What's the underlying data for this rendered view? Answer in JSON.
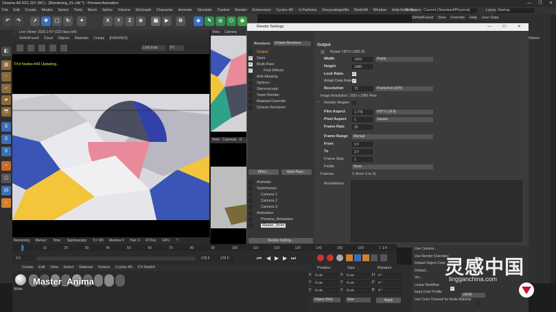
{
  "app": {
    "title": "Cinema 4D R21.207 (RC) - [Rendering_01.c4d *] - Preview Animation",
    "window_controls": [
      "—",
      "❐",
      "✕"
    ]
  },
  "menubar": {
    "items": [
      "File",
      "Edit",
      "Create",
      "Modes",
      "Select",
      "Tools",
      "Mesh",
      "Spline",
      "Volume",
      "MoGraph",
      "Character",
      "Animate",
      "Simulate",
      "Tracker",
      "Render",
      "Extensions",
      "Cycles 4D",
      "X-Particles",
      "Greyscalegorilla",
      "Redshift",
      "Window",
      "Help",
      "Octane"
    ],
    "node_space_label": "Node Space:",
    "node_space_value": "Current (Standard/Physical)",
    "layout_label": "Layout:",
    "layout_value": "Startup"
  },
  "right_header": {
    "items": [
      "StrNotFound",
      "View",
      "Override",
      "Help",
      "User Data"
    ],
    "owner": "Owner"
  },
  "live_viewer": {
    "title": "Live Viewer 2020.1-R7 (322 days left)",
    "menu": [
      "StrNotFound",
      "Cloud",
      "Objects",
      "Materials",
      "Comps",
      "[FINISHED]"
    ],
    "ldr": "LDR 8-bit",
    "pt": "PT",
    "status_overlay": "Tri'd Nodes:443  Updating..",
    "status_bar": [
      "Rendering",
      "Ms/sec:",
      "Time:",
      "Spp/maxspp:",
      "Tri: 0/0",
      "Meshes 0",
      "Hair: 0",
      "RTXon",
      "GPU:",
      "?"
    ]
  },
  "viewport2": {
    "tabs": [
      "View",
      "Camera"
    ],
    "tabs2": [
      "View",
      "Cameras",
      "D"
    ]
  },
  "render_settings": {
    "title": "Render Settings",
    "renderer_label": "Renderer",
    "renderer_value": "Octane Renderer",
    "tree": [
      {
        "label": "Output",
        "checked": false,
        "selected": true
      },
      {
        "label": "Save",
        "checked": true,
        "selected": false
      },
      {
        "label": "Multi-Pass",
        "checked": true,
        "selected": false
      },
      {
        "label": "Post Effects",
        "checked": true,
        "selected": false
      },
      {
        "label": "Anti-Aliasing",
        "checked": false,
        "selected": false
      },
      {
        "label": "Options",
        "checked": false,
        "selected": false
      },
      {
        "label": "Stereoscopic",
        "checked": false,
        "selected": false
      },
      {
        "label": "Team Render",
        "checked": false,
        "selected": false
      },
      {
        "label": "Material Override",
        "checked": false,
        "selected": false
      },
      {
        "label": "Octane Renderer",
        "checked": false,
        "selected": false
      }
    ],
    "effect_button": "Effect...",
    "multipass_button": "Multi-Pass...",
    "takes": [
      "Animatic",
      "Styleframes",
      "Camera 1",
      "Camera 2",
      "Camera 3",
      "Animation",
      "Preview_Animation",
      "Master_Anim"
    ],
    "render_setting_button": "Render Setting...",
    "output": {
      "section": "Output",
      "preset": "Preset: HDTV 1080 25",
      "width_label": "Width",
      "width_value": "1920",
      "width_unit": "Pixels",
      "height_label": "Height",
      "height_value": "1080",
      "lock_ratio": "Lock Ratio",
      "adapt_data_rate": "Adapt Data Rate",
      "resolution_label": "Resolution",
      "resolution_value": "72",
      "resolution_unit": "Pixels/Inch (DPI)",
      "image_resolution": "Image Resolution: 1920 x 1080 Pixel",
      "render_region": "Render Region",
      "film_aspect_label": "Film Aspect",
      "film_aspect_value": "1.778",
      "film_aspect_preset": "HDTV (16:9)",
      "pixel_aspect_label": "Pixel Aspect",
      "pixel_aspect_value": "1",
      "pixel_aspect_preset": "Square",
      "frame_rate_label": "Frame Rate",
      "frame_rate_value": "25",
      "frame_range_label": "Frame Range",
      "frame_range_value": "Manual",
      "from_label": "From",
      "from_value": "3 F",
      "to_label": "To",
      "to_value": "3 F",
      "frame_step_label": "Frame Step",
      "frame_step_value": "1",
      "fields_label": "Fields",
      "fields_value": "None",
      "frames_label": "Frames:",
      "frames_value": "1 (from 3 to 3)",
      "annotations": "Annotations"
    }
  },
  "timeline": {
    "ticks": [
      "0",
      "10",
      "20",
      "30",
      "40",
      "50",
      "60",
      "70",
      "80",
      "90",
      "100",
      "110",
      "120",
      "130",
      "140",
      "150",
      "160",
      "170"
    ],
    "start": "0 F",
    "current": "175 F",
    "end": "175 F",
    "frame_field": "1 F"
  },
  "material_manager": {
    "menu": [
      "Create",
      "Edit",
      "View",
      "Select",
      "Material",
      "Texture",
      "Cycles 4D",
      "CV-Switch"
    ],
    "material_name": "Master_Anima",
    "material_label": "White"
  },
  "coordinates": {
    "headers": [
      "Position",
      "Size",
      "Rotation"
    ],
    "rows": [
      {
        "axis": "X",
        "pos": "0 cm",
        "sizeaxis": "X",
        "size": "0 cm",
        "rotaxis": "H",
        "rot": "0 °"
      },
      {
        "axis": "Y",
        "pos": "0 cm",
        "sizeaxis": "Y",
        "size": "0 cm",
        "rotaxis": "P",
        "rot": "0 °"
      },
      {
        "axis": "Z",
        "pos": "0 cm",
        "sizeaxis": "Z",
        "size": "0 cm",
        "rotaxis": "B",
        "rot": "0 °"
      }
    ],
    "mode": "Object (Rel)",
    "size_mode": "Size",
    "apply": "Apply"
  },
  "attributes": {
    "items": [
      "Use Camera...",
      "Use Render Overrides",
      "Default Object Color",
      "Default...",
      "Vie...",
      "Linear Workflow",
      "Input Color Profile",
      "Use Color Channel for Node Material"
    ],
    "input_color_profile_value": "sRGB"
  },
  "watermark": {
    "cn": "灵感中国",
    "url": "lingganchina.com"
  },
  "colors": {
    "accent_blue": "#3a55b5",
    "pink": "#e88a9a",
    "yellow": "#f2c53a",
    "dark_bg": "#1d1d1d"
  }
}
